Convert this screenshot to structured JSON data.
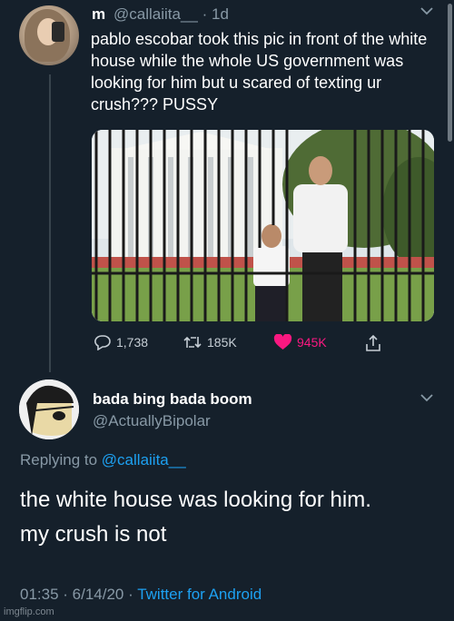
{
  "tweet": {
    "author_name": "m",
    "author_handle": "@callaiita__",
    "time": "· 1d",
    "text": "pablo escobar took this pic in front of the white house while the whole US government was looking for him but u scared of texting ur crush??? PUSSY",
    "stats": {
      "replies": "1,738",
      "retweets": "185K",
      "likes": "945K"
    },
    "icons": [
      "reply-icon",
      "retweet-icon",
      "like-icon",
      "share-icon",
      "chevron-down-icon"
    ]
  },
  "reply": {
    "author_name": "bada bing bada boom",
    "author_handle": "@ActuallyBipolar",
    "replying_prefix": "Replying to",
    "replying_to": "@callaiita__",
    "text_line1": "the white house was looking for him.",
    "text_line2": "my crush is not",
    "timestamp": "01:35 · 6/14/20 ·",
    "app": "Twitter for Android"
  },
  "watermark": "imgflip.com",
  "colors": {
    "background": "#15202b",
    "secondary_text": "#8899a6",
    "link": "#1da1f2",
    "like": "#f91880"
  }
}
